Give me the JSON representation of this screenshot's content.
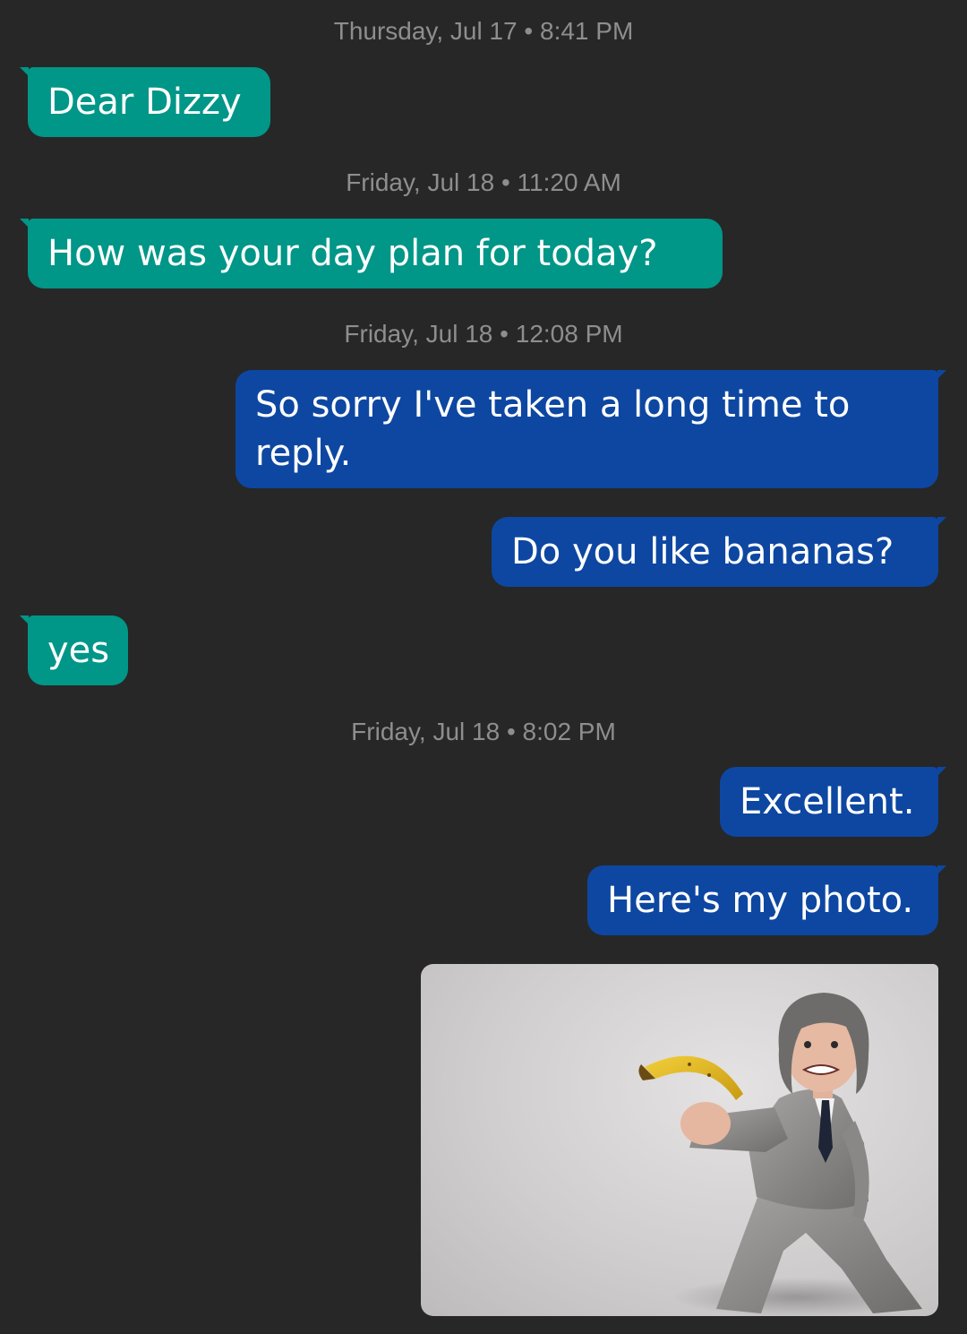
{
  "colors": {
    "background": "#272727",
    "incoming_bubble": "#009688",
    "outgoing_bubble": "#0d47a1",
    "timestamp_text": "#8e8e8e",
    "message_text": "#ffffff"
  },
  "conversation": {
    "timestamps": [
      "Thursday, Jul 17 • 8:41 PM",
      "Friday, Jul 18 • 11:20 AM",
      "Friday, Jul 18 • 12:08 PM",
      "Friday, Jul 18 • 8:02 PM"
    ],
    "messages": [
      {
        "direction": "incoming",
        "text": "Dear Dizzy"
      },
      {
        "direction": "incoming",
        "text": "How was your day plan for today?"
      },
      {
        "direction": "outgoing",
        "text": "So sorry I've taken a long time to reply."
      },
      {
        "direction": "outgoing",
        "text": "Do you like bananas?"
      },
      {
        "direction": "incoming",
        "text": "yes"
      },
      {
        "direction": "outgoing",
        "text": "Excellent."
      },
      {
        "direction": "outgoing",
        "text": "Here's my photo."
      }
    ],
    "photo": {
      "type": "image-attachment",
      "icon": "photo-of-man-holding-banana"
    }
  }
}
